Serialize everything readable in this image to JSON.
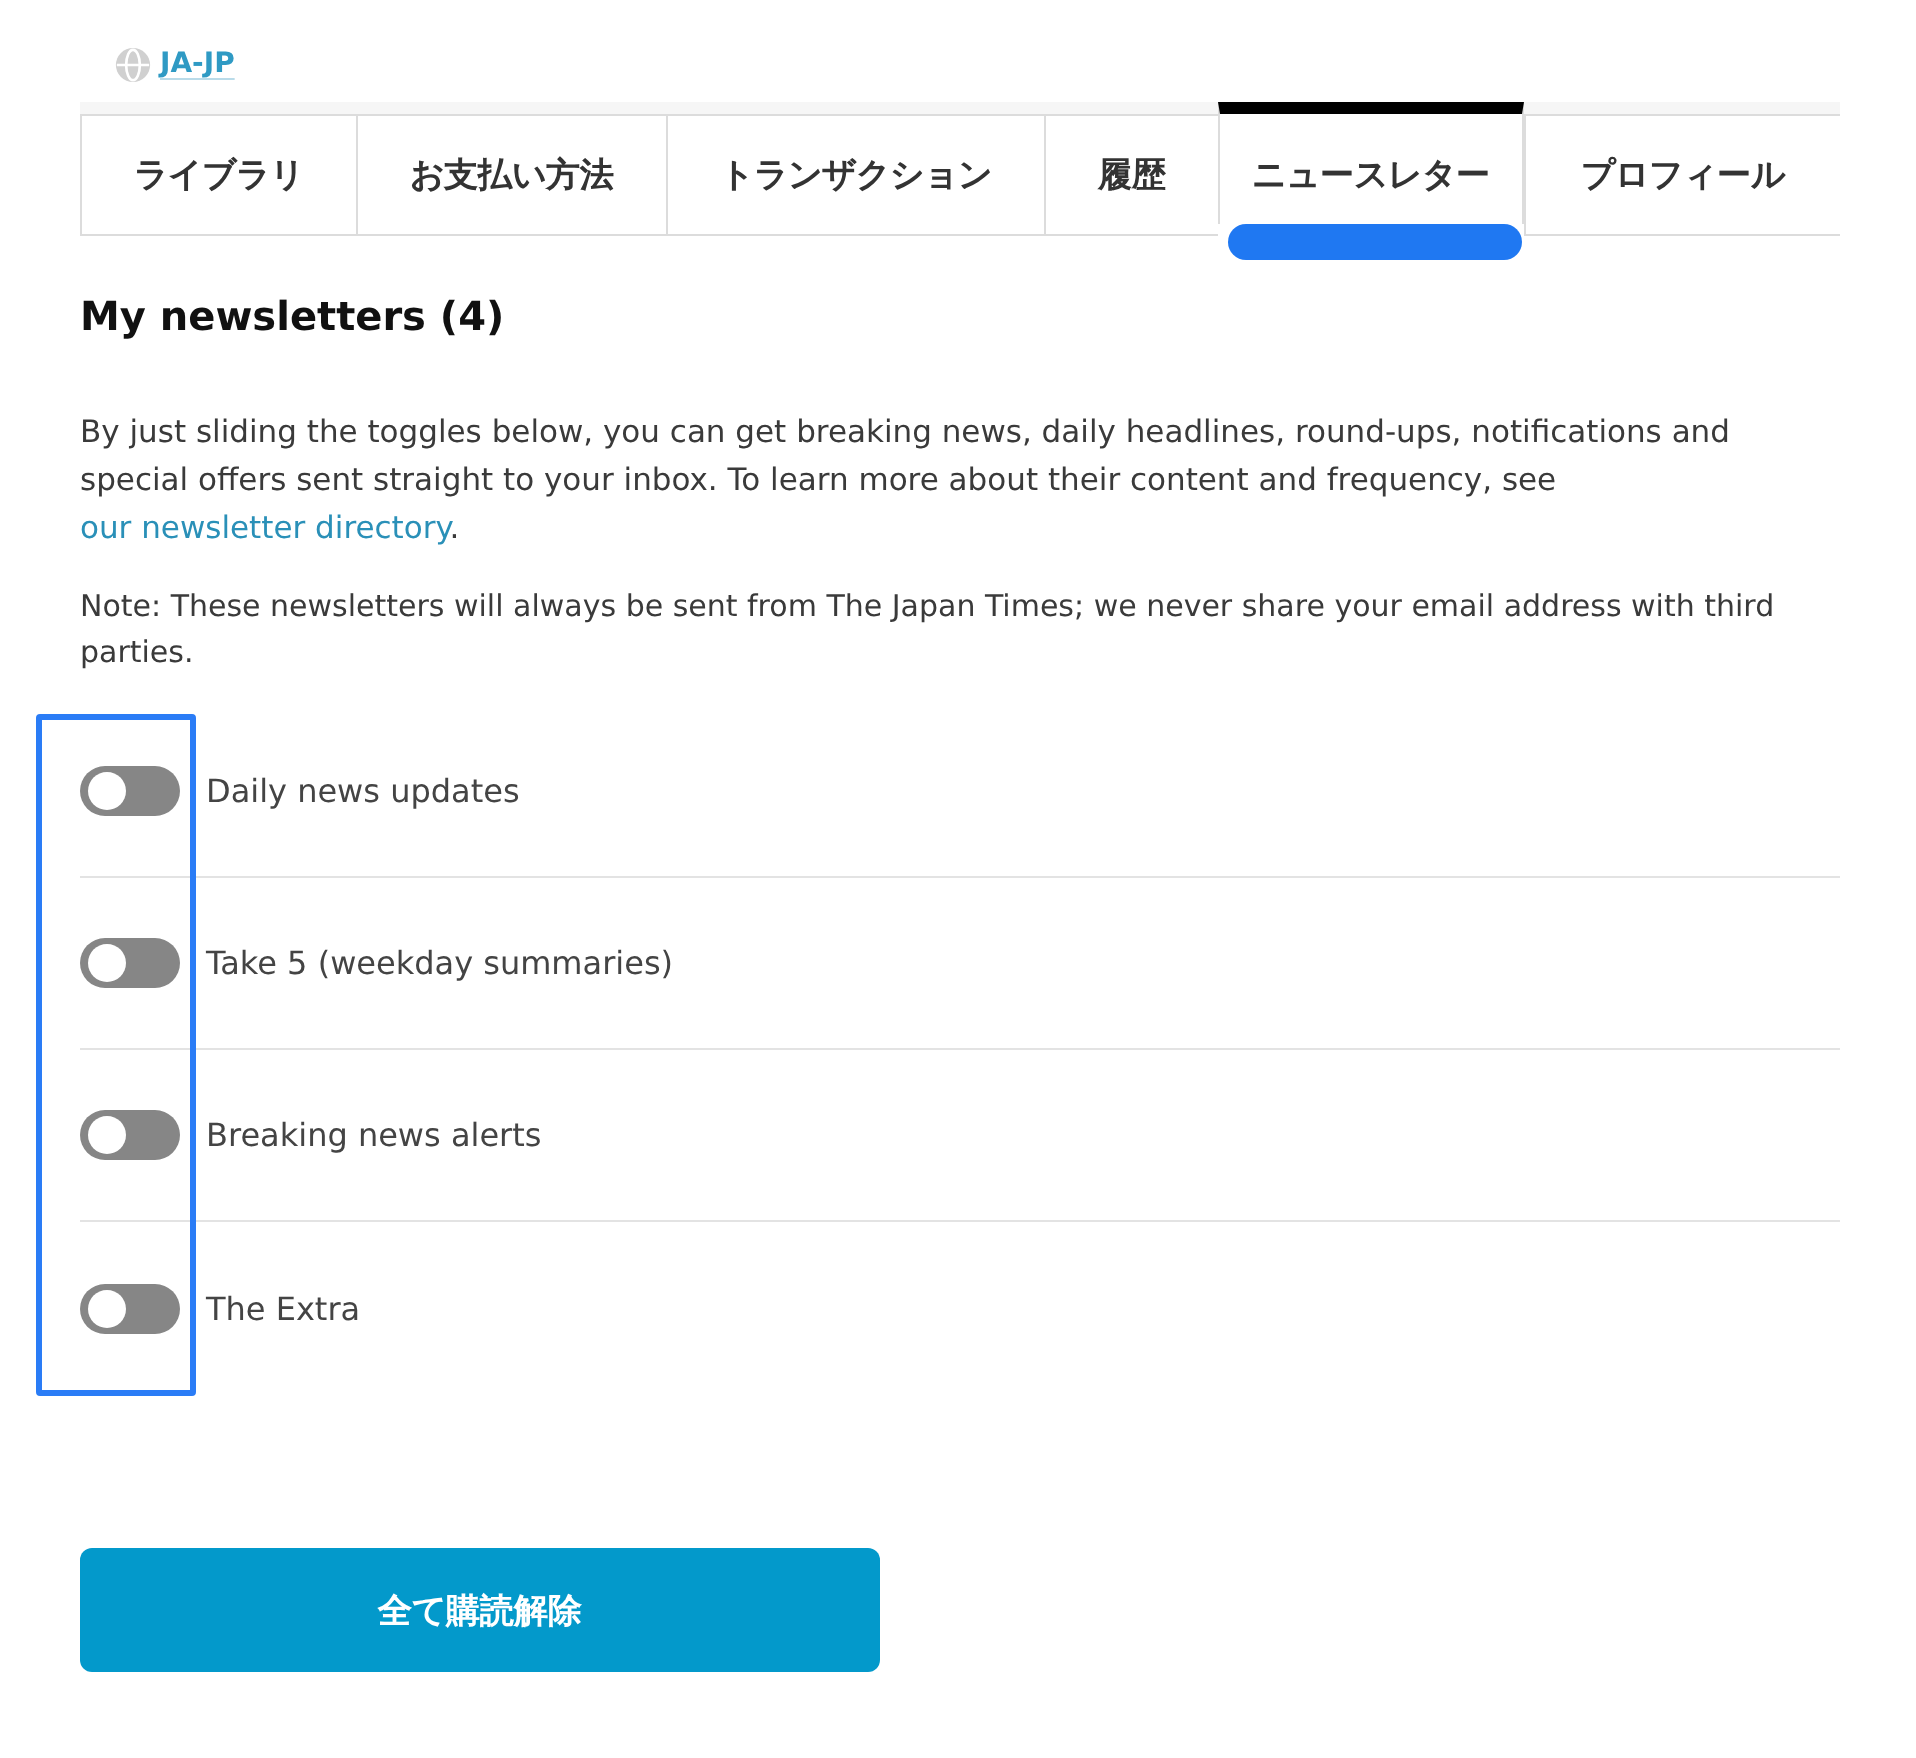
{
  "language": {
    "code": "JA-JP"
  },
  "tabs": [
    {
      "label": "ライブラリ",
      "selected": false,
      "underlined": false
    },
    {
      "label": "お支払い方法",
      "selected": false,
      "underlined": false
    },
    {
      "label": "トランザクション",
      "selected": false,
      "underlined": false
    },
    {
      "label": "履歴",
      "selected": false,
      "underlined": false
    },
    {
      "label": "ニュースレター",
      "selected": true,
      "underlined": true
    },
    {
      "label": "プロフィール",
      "selected": false,
      "underlined": false
    }
  ],
  "section": {
    "title": "My newsletters (4)",
    "intro": {
      "before": "By just sliding the toggles below, you can get breaking news, daily headlines, round-ups, notifications and special offers sent straight to your inbox. To learn more about their content and frequency, see",
      "link": "our newsletter directory",
      "after": "."
    },
    "note": "Note: These newsletters will always be sent from The Japan Times; we never share your email address with third parties."
  },
  "newsletters": [
    {
      "name": "Daily news updates",
      "on": false
    },
    {
      "name": "Take 5 (weekday summaries)",
      "on": false
    },
    {
      "name": "Breaking news alerts",
      "on": false
    },
    {
      "name": "The Extra",
      "on": false
    }
  ],
  "toggles_framed": true,
  "button": {
    "label": "全て購読解除"
  }
}
